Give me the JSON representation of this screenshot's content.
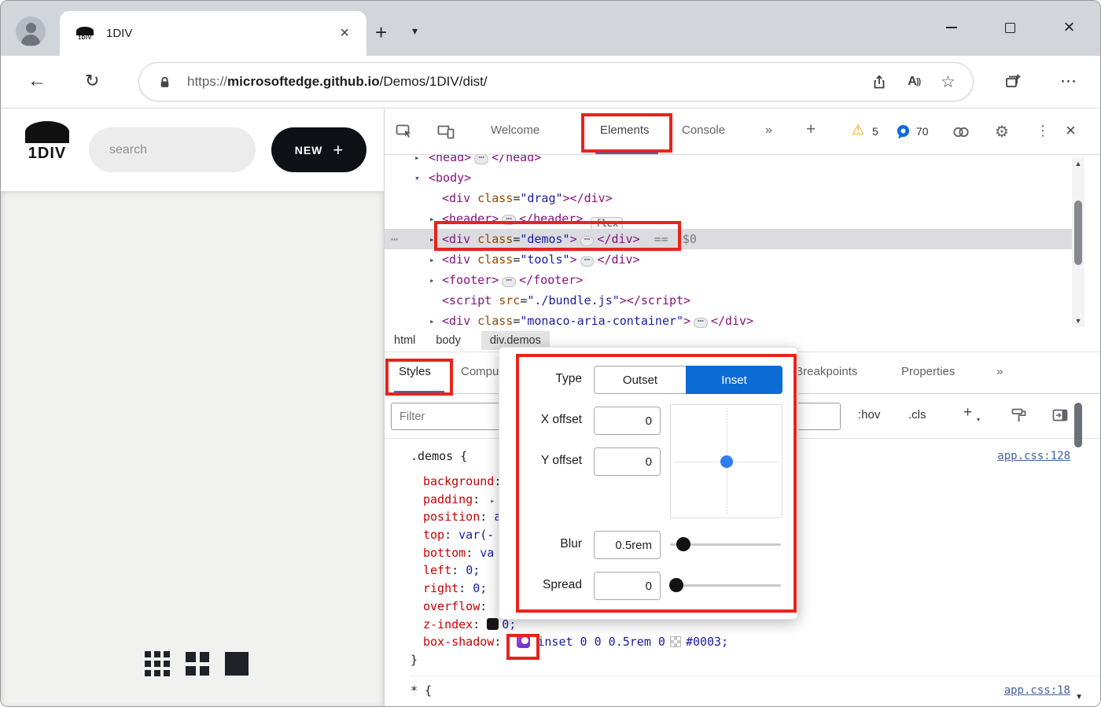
{
  "browser": {
    "tab_title": "1DIV",
    "url": {
      "scheme": "https://",
      "domain": "microsoftedge.github.io",
      "path": "/Demos/1DIV/dist/"
    },
    "read_aloud_a": "A",
    "read_aloud_waves": "))"
  },
  "app": {
    "logo_text": "1DIV",
    "search_placeholder": "search",
    "new_button_label": "NEW",
    "new_button_plus": "+"
  },
  "devtools": {
    "tabs": [
      "Welcome",
      "Elements",
      "Console"
    ],
    "active_tab": "Elements",
    "warnings_count": "5",
    "issues_count": "70",
    "dom": {
      "lines": [
        {
          "lvl": 1,
          "arrow": "c",
          "parts": [
            [
              "t",
              "<head>"
            ],
            [
              "pill",
              ""
            ],
            [
              "t",
              "</head>"
            ]
          ]
        },
        {
          "lvl": 1,
          "arrow": "e",
          "parts": [
            [
              "t",
              "<body>"
            ]
          ]
        },
        {
          "lvl": 2,
          "arrow": "",
          "parts": [
            [
              "t",
              "<div "
            ],
            [
              "a",
              "class"
            ],
            [
              "p",
              "="
            ],
            [
              "s",
              "\"drag\""
            ],
            [
              "t",
              "></div>"
            ]
          ]
        },
        {
          "lvl": 2,
          "arrow": "c",
          "parts": [
            [
              "t",
              "<header>"
            ],
            [
              "pill",
              ""
            ],
            [
              "t",
              "</header>"
            ],
            [
              "badge",
              "flex"
            ]
          ]
        },
        {
          "lvl": 2,
          "arrow": "c",
          "selected": true,
          "dots": true,
          "parts": [
            [
              "t",
              "<div "
            ],
            [
              "a",
              "class"
            ],
            [
              "p",
              "="
            ],
            [
              "s",
              "\"demos\""
            ],
            [
              "t",
              ">"
            ],
            [
              "pill",
              ""
            ],
            [
              "t",
              "</div>"
            ],
            [
              "g",
              "  ==  $0"
            ]
          ]
        },
        {
          "lvl": 2,
          "arrow": "c",
          "parts": [
            [
              "t",
              "<div "
            ],
            [
              "a",
              "class"
            ],
            [
              "p",
              "="
            ],
            [
              "s",
              "\"tools\""
            ],
            [
              "t",
              ">"
            ],
            [
              "pill",
              ""
            ],
            [
              "t",
              "</div>"
            ]
          ]
        },
        {
          "lvl": 2,
          "arrow": "c",
          "parts": [
            [
              "t",
              "<footer>"
            ],
            [
              "pill",
              ""
            ],
            [
              "t",
              "</footer>"
            ]
          ]
        },
        {
          "lvl": 2,
          "arrow": "",
          "parts": [
            [
              "t",
              "<script "
            ],
            [
              "a",
              "src"
            ],
            [
              "p",
              "="
            ],
            [
              "s",
              "\"./bundle.js\""
            ],
            [
              "t",
              "></script>"
            ]
          ]
        },
        {
          "lvl": 2,
          "arrow": "c",
          "parts": [
            [
              "t",
              "<div "
            ],
            [
              "a",
              "class"
            ],
            [
              "p",
              "="
            ],
            [
              "s",
              "\"monaco-aria-container\""
            ],
            [
              "t",
              ">"
            ],
            [
              "pill",
              ""
            ],
            [
              "t",
              "</div>"
            ]
          ]
        }
      ]
    },
    "breadcrumbs": [
      "html",
      "body",
      "div.demos"
    ],
    "styles_tabs": [
      "Styles",
      "Computed",
      "DOM Breakpoints",
      "Properties"
    ],
    "filter_placeholder": "Filter",
    "pseudo_toggle": ":hov",
    "class_toggle": ".cls",
    "rules": [
      {
        "selector": ".demos {",
        "link": "app.css:128",
        "close": "}",
        "decls": [
          {
            "n": "background",
            "v": ""
          },
          {
            "n": "padding",
            "v": "",
            "expand": true
          },
          {
            "n": "position",
            "v": "a"
          },
          {
            "n": "top",
            "v": "var(-"
          },
          {
            "n": "bottom",
            "v": "va"
          },
          {
            "n": "left",
            "v": "0;"
          },
          {
            "n": "right",
            "v": "0;"
          },
          {
            "n": "overflow",
            "v": ""
          },
          {
            "n": "z-index",
            "v": "0;",
            "dark": true
          },
          {
            "n": "box-shadow",
            "v": "inset 0 0 0.5rem 0",
            "icon": true,
            "checker": true,
            "v2": "#0003;"
          }
        ]
      },
      {
        "selector": "* {",
        "link": "app.css:18",
        "decls": []
      }
    ]
  },
  "popup": {
    "type_label": "Type",
    "outset_label": "Outset",
    "inset_label": "Inset",
    "x_label": "X offset",
    "x_value": "0",
    "y_label": "Y offset",
    "y_value": "0",
    "blur_label": "Blur",
    "blur_value": "0.5rem",
    "spread_label": "Spread",
    "spread_value": "0"
  },
  "colors": {
    "accent_blue": "#0c6cd6",
    "annotation_red": "#e8231d",
    "warning_orange": "#f09d00"
  },
  "icons": {
    "back": "←",
    "refresh": "↻",
    "star": "☆",
    "more_h": "⋯",
    "more_v": "⋮",
    "close": "×",
    "new_tab": "+",
    "tab_chevron": "▾",
    "overflow": "»",
    "add": "+",
    "warning": "⚠",
    "gear": "⚙",
    "dots": "⋯",
    "tree_collapsed": "▸",
    "tree_expanded": "▾",
    "scroll_up": "▲",
    "scroll_down": "▼"
  }
}
